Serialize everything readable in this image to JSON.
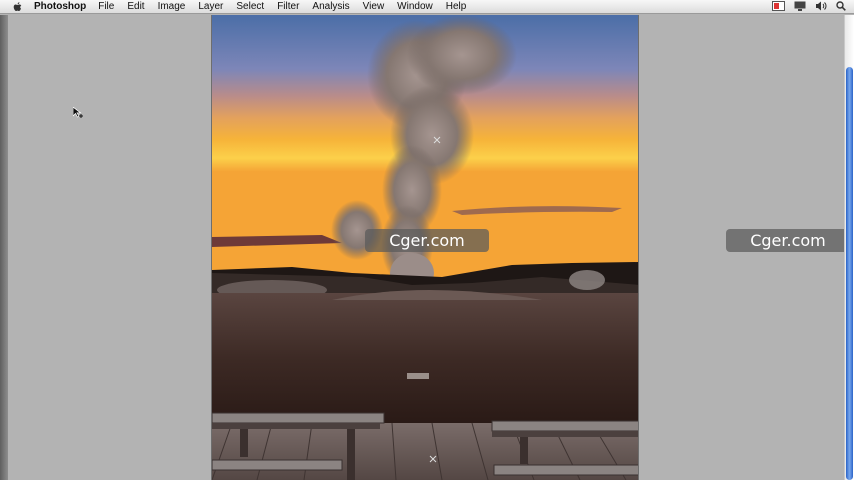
{
  "menubar": {
    "apple_icon": "apple-icon",
    "app_name": "Photoshop",
    "items": [
      "File",
      "Edit",
      "Image",
      "Layer",
      "Select",
      "Filter",
      "Analysis",
      "View",
      "Window",
      "Help"
    ],
    "status_icons": [
      "fast-user-switch-icon",
      "display-icon",
      "volume-icon",
      "spotlight-search-icon"
    ]
  },
  "watermarks": [
    "Cger.com",
    "Cger.com"
  ],
  "colors": {
    "workspace": "#b3b3b3",
    "scroll_thumb": "#3a75d6",
    "watermark_bg": "#5a5a5a"
  },
  "cursor_icon": "arrow-cursor-icon"
}
